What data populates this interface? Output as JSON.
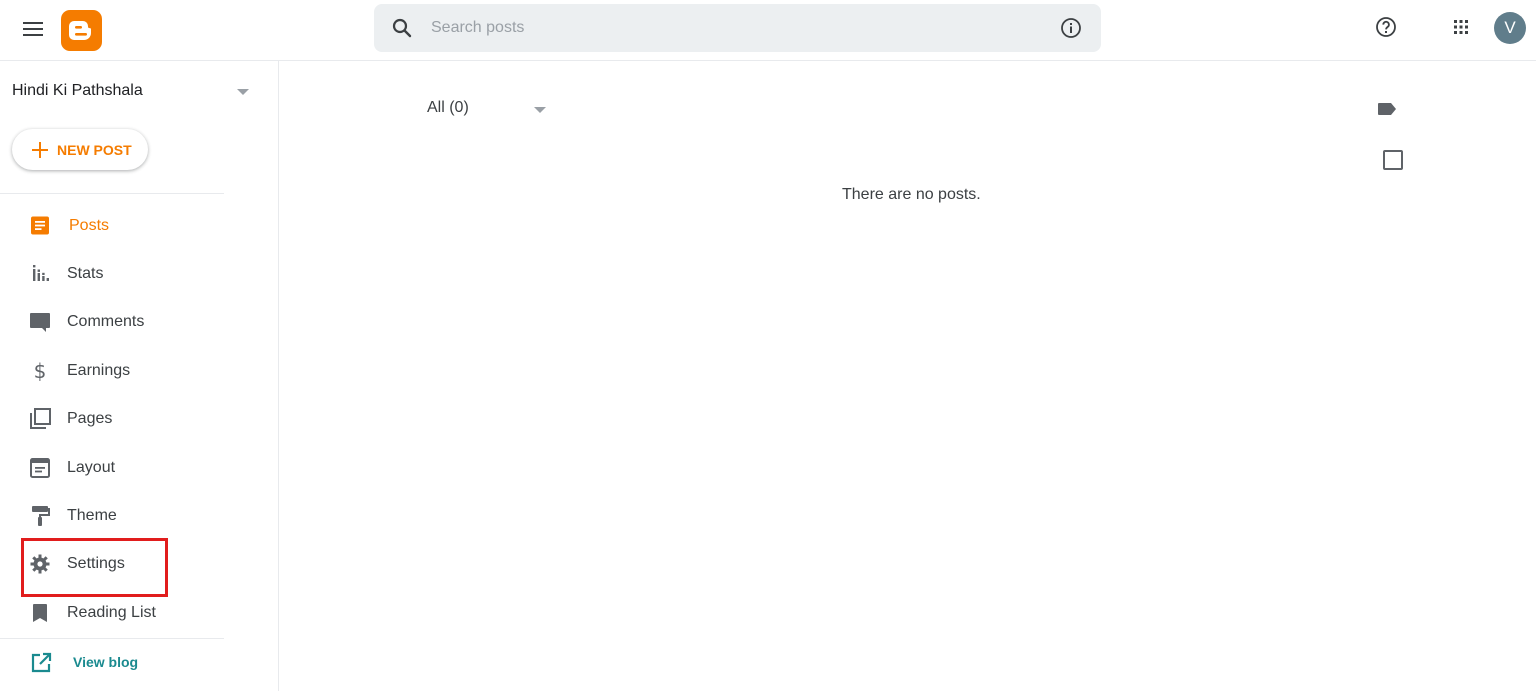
{
  "header": {
    "menu_icon": "hamburger-menu-icon",
    "logo_icon": "blogger-logo",
    "search": {
      "placeholder": "Search posts",
      "value": ""
    },
    "info_icon": "info-icon",
    "help_icon": "help-icon",
    "apps_icon": "apps-grid-icon",
    "avatar_letter": "V"
  },
  "sidebar": {
    "blog_name": "Hindi Ki Pathshala",
    "new_post_label": "NEW POST",
    "items": [
      {
        "label": "Posts",
        "icon": "posts-icon",
        "active": true
      },
      {
        "label": "Stats",
        "icon": "stats-icon"
      },
      {
        "label": "Comments",
        "icon": "comments-icon"
      },
      {
        "label": "Earnings",
        "icon": "dollar-icon"
      },
      {
        "label": "Pages",
        "icon": "pages-icon"
      },
      {
        "label": "Layout",
        "icon": "layout-icon"
      },
      {
        "label": "Theme",
        "icon": "paint-roller-icon"
      },
      {
        "label": "Settings",
        "icon": "gear-icon",
        "highlighted": true
      },
      {
        "label": "Reading List",
        "icon": "bookmark-icon"
      }
    ],
    "view_blog_label": "View blog"
  },
  "main": {
    "filter_label": "All (0)",
    "empty_message": "There are no posts."
  },
  "colors": {
    "accent": "#f57c00",
    "icon_gray": "#5f6368",
    "link_teal": "#1a8a8f",
    "highlight_red": "#e11d1d",
    "avatar_bg": "#607d8b"
  }
}
